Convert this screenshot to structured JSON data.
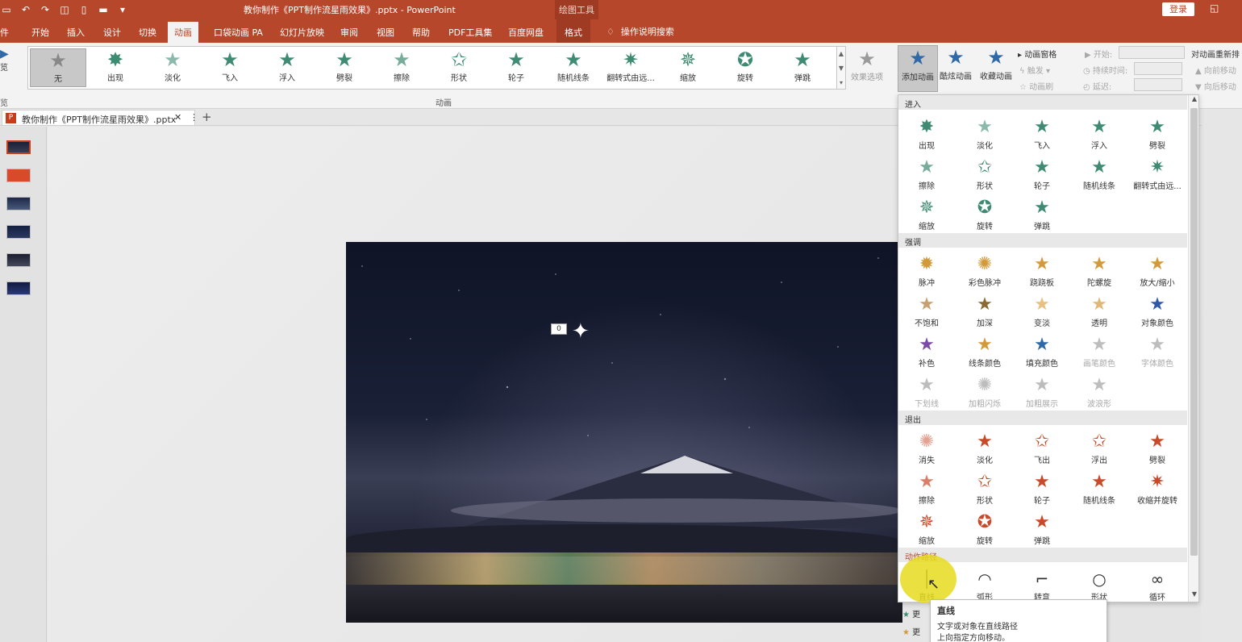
{
  "titlebar": {
    "doc_title": "教你制作《PPT制作流星雨效果》.pptx  -  PowerPoint",
    "tool_group": "绘图工具",
    "login": "登录"
  },
  "tabs": {
    "file": "件",
    "home": "开始",
    "insert": "插入",
    "design": "设计",
    "transitions": "切换",
    "animations": "动画",
    "pocket": "口袋动画 PA",
    "slideshow": "幻灯片放映",
    "review": "审阅",
    "view": "视图",
    "help": "帮助",
    "pdf": "PDF工具集",
    "baidu": "百度网盘",
    "format": "格式",
    "search": "操作说明搜索"
  },
  "ribbon": {
    "preview_label": "览",
    "preview_group": "览",
    "gallery": [
      "无",
      "出现",
      "淡化",
      "飞入",
      "浮入",
      "劈裂",
      "擦除",
      "形状",
      "轮子",
      "随机线条",
      "翻转式由远...",
      "缩放",
      "旋转",
      "弹跳"
    ],
    "effect_options": "效果选项",
    "group_label": "动画",
    "add_animation": "添加动画",
    "brush_animation": "酷炫动画",
    "fav_animation": "收藏动画",
    "anim_pane": "动画窗格",
    "trigger": "触发",
    "anim_painter": "动画刷",
    "start": "开始:",
    "duration": "持续时间:",
    "delay": "延迟:",
    "reorder": "对动画重新排",
    "move_earlier": "向前移动",
    "move_later": "向后移动"
  },
  "doc_tab": {
    "name": "教你制作《PPT制作流星雨效果》.pptx"
  },
  "slide": {
    "badge": "0"
  },
  "panel": {
    "enter_title": "进入",
    "enter": [
      "出现",
      "淡化",
      "飞入",
      "浮入",
      "劈裂",
      "擦除",
      "形状",
      "轮子",
      "随机线条",
      "翻转式由远...",
      "缩放",
      "旋转",
      "弹跳"
    ],
    "emph_title": "强调",
    "emph": [
      "脉冲",
      "彩色脉冲",
      "跷跷板",
      "陀螺旋",
      "放大/缩小",
      "不饱和",
      "加深",
      "变淡",
      "透明",
      "对象颜色",
      "补色",
      "线条颜色",
      "填充颜色",
      "画笔颜色",
      "字体颜色",
      "下划线",
      "加粗闪烁",
      "加粗展示",
      "波浪形"
    ],
    "exit_title": "退出",
    "exit": [
      "消失",
      "淡化",
      "飞出",
      "浮出",
      "劈裂",
      "擦除",
      "形状",
      "轮子",
      "随机线条",
      "收缩并旋转",
      "缩放",
      "旋转",
      "弹跳"
    ],
    "path_title": "动作路径",
    "path": [
      "直线",
      "弧形",
      "转弯",
      "形状",
      "循环"
    ],
    "more1": "更",
    "more2": "更"
  },
  "tooltip": {
    "title": "直线",
    "line1": "文字或对象在直线路径",
    "line2": "上向指定方向移动。"
  }
}
